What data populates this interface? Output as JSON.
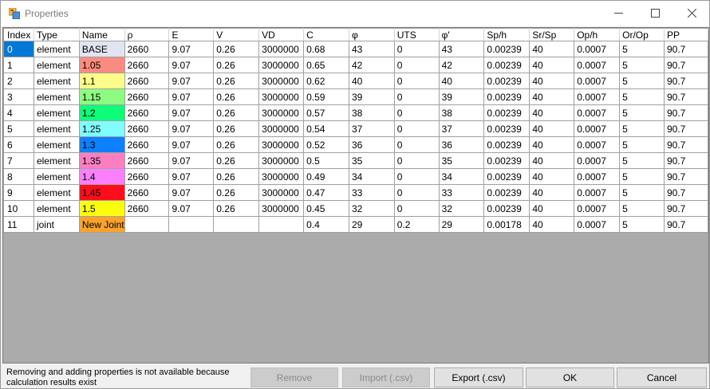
{
  "window": {
    "title": "Properties"
  },
  "table": {
    "columns": [
      "Index",
      "Type",
      "Name",
      "ρ",
      "E",
      "V",
      "VD",
      "C",
      "φ",
      "UTS",
      "φ'",
      "Sp/h",
      "Sr/Sp",
      "Op/h",
      "Or/Op",
      "PP"
    ],
    "rows": [
      {
        "cells": [
          "0",
          "element",
          "BASE",
          "2660",
          "9.07",
          "0.26",
          "3000000",
          "0.68",
          "43",
          "0",
          "43",
          "0.00239",
          "40",
          "0.0007",
          "5",
          "90.7"
        ],
        "color": "#e1e5f2"
      },
      {
        "cells": [
          "1",
          "element",
          "1.05",
          "2660",
          "9.07",
          "0.26",
          "3000000",
          "0.65",
          "42",
          "0",
          "42",
          "0.00239",
          "40",
          "0.0007",
          "5",
          "90.7"
        ],
        "color": "#fa8b80"
      },
      {
        "cells": [
          "2",
          "element",
          "1.1",
          "2660",
          "9.07",
          "0.26",
          "3000000",
          "0.62",
          "40",
          "0",
          "40",
          "0.00239",
          "40",
          "0.0007",
          "5",
          "90.7"
        ],
        "color": "#fbfc8a"
      },
      {
        "cells": [
          "3",
          "element",
          "1.15",
          "2660",
          "9.07",
          "0.26",
          "3000000",
          "0.59",
          "39",
          "0",
          "39",
          "0.00239",
          "40",
          "0.0007",
          "5",
          "90.7"
        ],
        "color": "#8dfb81"
      },
      {
        "cells": [
          "4",
          "element",
          "1.2",
          "2660",
          "9.07",
          "0.26",
          "3000000",
          "0.57",
          "38",
          "0",
          "38",
          "0.00239",
          "40",
          "0.0007",
          "5",
          "90.7"
        ],
        "color": "#0dfc79"
      },
      {
        "cells": [
          "5",
          "element",
          "1.25",
          "2660",
          "9.07",
          "0.26",
          "3000000",
          "0.54",
          "37",
          "0",
          "37",
          "0.00239",
          "40",
          "0.0007",
          "5",
          "90.7"
        ],
        "color": "#80fdfc"
      },
      {
        "cells": [
          "6",
          "element",
          "1.3",
          "2660",
          "9.07",
          "0.26",
          "3000000",
          "0.52",
          "36",
          "0",
          "36",
          "0.00239",
          "40",
          "0.0007",
          "5",
          "90.7"
        ],
        "color": "#0d80fd"
      },
      {
        "cells": [
          "7",
          "element",
          "1.35",
          "2660",
          "9.07",
          "0.26",
          "3000000",
          "0.5",
          "35",
          "0",
          "35",
          "0.00239",
          "40",
          "0.0007",
          "5",
          "90.7"
        ],
        "color": "#fb7fc0"
      },
      {
        "cells": [
          "8",
          "element",
          "1.4",
          "2660",
          "9.07",
          "0.26",
          "3000000",
          "0.49",
          "34",
          "0",
          "34",
          "0.00239",
          "40",
          "0.0007",
          "5",
          "90.7"
        ],
        "color": "#fb7ffb"
      },
      {
        "cells": [
          "9",
          "element",
          "1.45",
          "2660",
          "9.07",
          "0.26",
          "3000000",
          "0.47",
          "33",
          "0",
          "33",
          "0.00239",
          "40",
          "0.0007",
          "5",
          "90.7"
        ],
        "color": "#fc0d1c"
      },
      {
        "cells": [
          "10",
          "element",
          "1.5",
          "2660",
          "9.07",
          "0.26",
          "3000000",
          "0.45",
          "32",
          "0",
          "32",
          "0.00239",
          "40",
          "0.0007",
          "5",
          "90.7"
        ],
        "color": "#fcfd0e"
      },
      {
        "cells": [
          "11",
          "joint",
          "New Joint",
          "",
          "",
          "",
          "",
          "0.4",
          "29",
          "0.2",
          "29",
          "0.00178",
          "40",
          "0.0007",
          "5",
          "90.7"
        ],
        "color": "#fba328"
      }
    ],
    "selected_row": 0
  },
  "status": {
    "message": "Removing and adding properties is not available because calculation results exist"
  },
  "buttons": {
    "remove": "Remove",
    "import": "Import (.csv)",
    "export": "Export (.csv)",
    "ok": "OK",
    "cancel": "Cancel"
  }
}
